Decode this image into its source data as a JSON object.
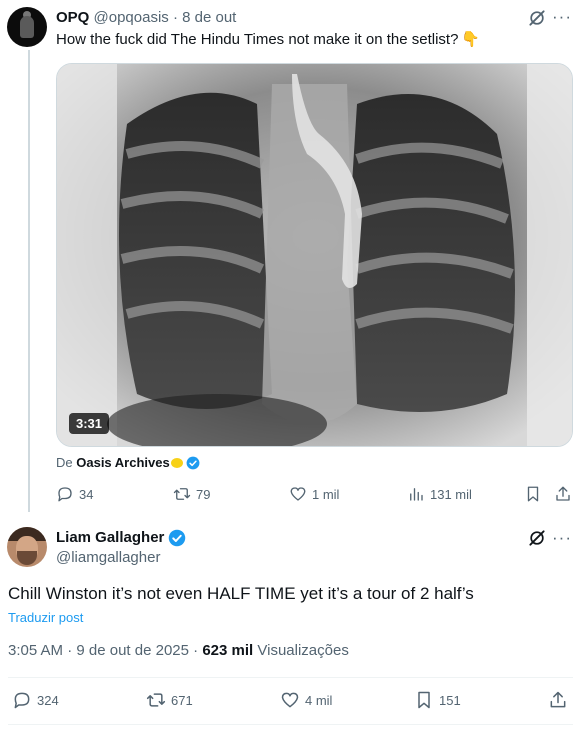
{
  "parent_tweet": {
    "display_name": "OPQ",
    "handle": "@opqoasis",
    "separator": "·",
    "date": "8 de out",
    "text": "How the fuck did The Hindu Times not make it on the setlist?",
    "video": {
      "duration": "3:31"
    },
    "source": {
      "prefix": "De",
      "account": "Oasis Archives"
    },
    "actions": {
      "replies": "34",
      "reposts": "79",
      "likes": "1 mil",
      "views": "131 mil"
    }
  },
  "main_tweet": {
    "display_name": "Liam Gallagher",
    "handle": "@liamgallagher",
    "text": "Chill Winston it’s not even HALF TIME yet it’s a tour of 2 half’s",
    "translate_label": "Traduzir post",
    "time": "3:05 AM",
    "date": "9 de out de 2025",
    "separator": "·",
    "views_count": "623 mil",
    "views_label": "Visualizações",
    "actions": {
      "replies": "324",
      "reposts": "671",
      "likes": "4 mil",
      "bookmarks": "151"
    }
  },
  "icons": {
    "reply": "reply-icon",
    "repost": "repost-icon",
    "like": "heart-icon",
    "views": "views-bar-icon",
    "bookmark": "bookmark-icon",
    "share": "share-icon",
    "grok": "grok-icon",
    "more": "more-icon",
    "verified": "verified-badge-icon"
  },
  "colors": {
    "text": "#0f1419",
    "muted": "#536471",
    "link": "#1d9bf0",
    "verified": "#1d9bf0",
    "border": "#cfd9de",
    "divider": "#eff3f4"
  }
}
